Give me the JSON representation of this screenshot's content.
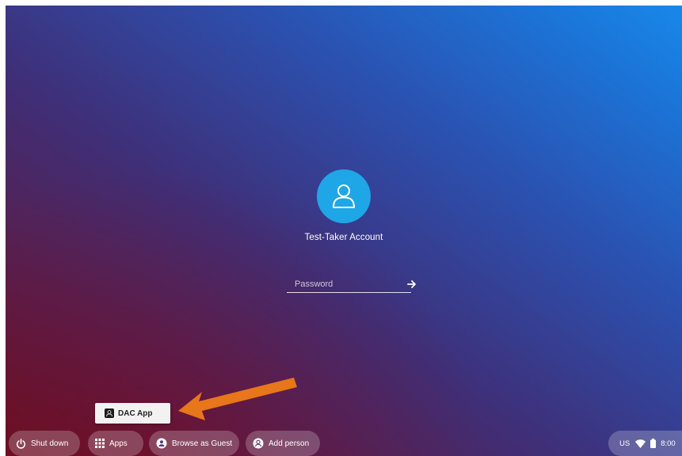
{
  "login": {
    "account_name": "Test-Taker Account",
    "password_placeholder": "Password",
    "password_value": ""
  },
  "app_popup": {
    "label": "DAC App",
    "icon": "dac-app-icon"
  },
  "shelf": {
    "shutdown_label": "Shut down",
    "apps_label": "Apps",
    "guest_label": "Browse as Guest",
    "add_person_label": "Add person"
  },
  "status_tray": {
    "ime": "US",
    "time": "8:00",
    "wifi_icon": "wifi-icon",
    "battery_icon": "battery-icon"
  },
  "colors": {
    "avatar_bg": "#1fa6e6",
    "annotation_arrow": "#e8761a",
    "popup_bg": "#f2f2f2"
  }
}
